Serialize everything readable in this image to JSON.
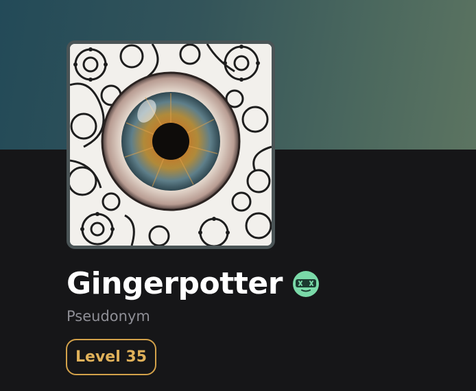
{
  "profile": {
    "username": "Gingerpotter",
    "subtitle": "Pseudonym",
    "level_label": "Level 35",
    "status_icon": "gamer-face-icon",
    "avatar": "eye-artwork"
  },
  "colors": {
    "banner_start": "#234a58",
    "banner_end": "#5c7461",
    "background": "#161618",
    "level_accent": "#d4a24a",
    "status_icon": "#7ad9a8"
  }
}
